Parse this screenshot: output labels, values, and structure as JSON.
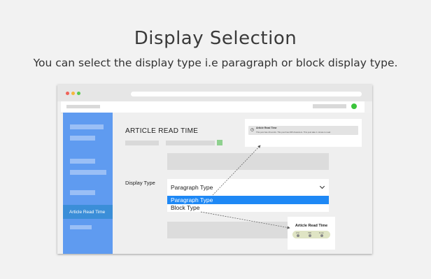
{
  "page": {
    "heading": "Display Selection",
    "subheading": "You can select the display type i.e paragraph or block display type."
  },
  "browser": {
    "traffic_lights": [
      "#f0635a",
      "#f5b73c",
      "#58c94e"
    ],
    "status_dot_color": "#3bc43b"
  },
  "sidebar": {
    "active_item": "Article Read Time",
    "accent": "#5f9bf0",
    "active_bg": "#3b8ed8"
  },
  "main": {
    "title": "ARTICLE READ TIME",
    "display_type_label": "Display Type",
    "select": {
      "value": "Paragraph Type",
      "options": [
        "Paragraph Type",
        "Block Type"
      ],
      "highlight_color": "#1e88f5"
    }
  },
  "preview_paragraph": {
    "title": "Article Read Time",
    "body": "This post has 29 words. This post has 268 characters. This post take 1 minute to read."
  },
  "preview_block": {
    "title": "Article Read Time",
    "values": [
      "172",
      "798",
      "8 min"
    ]
  }
}
